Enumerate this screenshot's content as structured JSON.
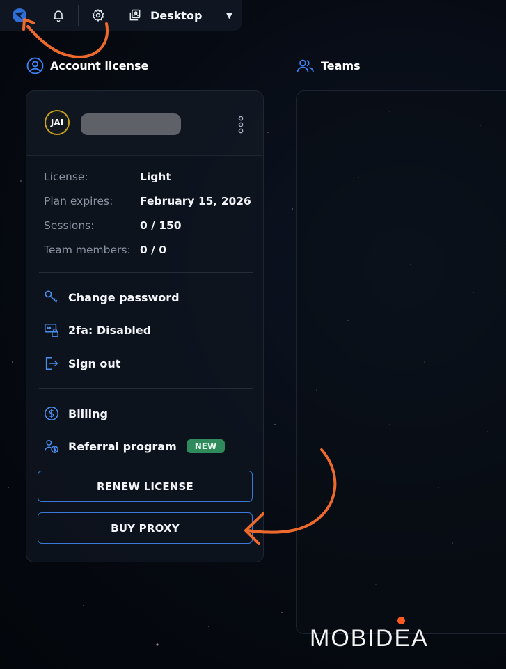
{
  "topbar": {
    "logo_icon": "app-logo-icon",
    "notification_icon": "bell-icon",
    "settings_icon": "gear-icon",
    "desktop_icon": "desktop-profile-icon",
    "desktop_label": "Desktop",
    "caret_icon": "caret-down-icon"
  },
  "account": {
    "title": "Account license",
    "avatar_initials": "JAI",
    "info": [
      {
        "label": "License:",
        "value": "Light"
      },
      {
        "label": "Plan expires:",
        "value": "February 15, 2026"
      },
      {
        "label": "Sessions:",
        "value": "0 / 150"
      },
      {
        "label": "Team members:",
        "value": "0 / 0"
      }
    ],
    "menu": {
      "change_password": "Change password",
      "twofa": "2fa: Disabled",
      "sign_out": "Sign out",
      "billing": "Billing",
      "referral": "Referral program",
      "referral_badge": "NEW"
    },
    "renew_button": "RENEW LICENSE",
    "proxy_button": "BUY PROXY"
  },
  "teams": {
    "title": "Teams"
  },
  "watermark": "MOBIDEA",
  "colors": {
    "accent_blue": "#3b78d6",
    "annotation_orange": "#ee6a2c",
    "badge_green": "#2f8a5c",
    "avatar_ring": "#c9a11b"
  }
}
